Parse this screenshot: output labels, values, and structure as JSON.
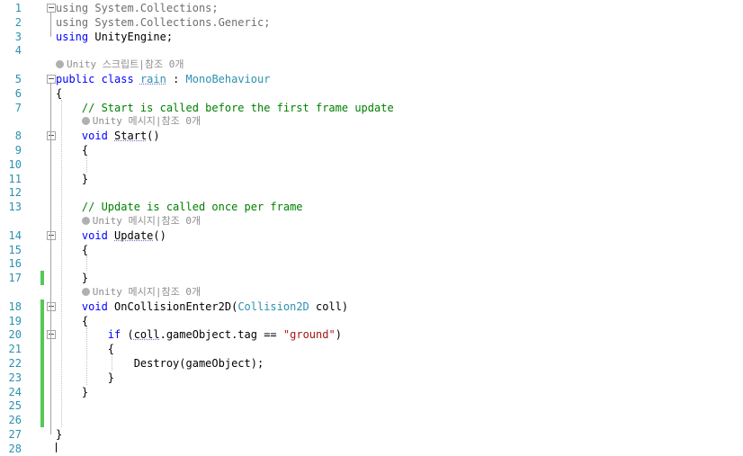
{
  "editor": {
    "language": "csharp",
    "lines": [
      {
        "num": "1",
        "segments": [
          {
            "t": "using",
            "c": "d"
          },
          {
            "t": " System.Collections;",
            "c": "d"
          }
        ]
      },
      {
        "num": "2",
        "segments": [
          {
            "t": "using",
            "c": "d"
          },
          {
            "t": " System.Collections.Generic;",
            "c": "d"
          }
        ]
      },
      {
        "num": "3",
        "segments": [
          {
            "t": "using",
            "c": "k"
          },
          {
            "t": " UnityEngine;",
            "c": ""
          }
        ]
      },
      {
        "num": "4",
        "segments": []
      },
      {
        "lens": "Unity 스크립트|참조 0개"
      },
      {
        "num": "5",
        "segments": [
          {
            "t": "public",
            "c": "k"
          },
          {
            "t": " ",
            "c": ""
          },
          {
            "t": "class",
            "c": "k"
          },
          {
            "t": " ",
            "c": ""
          },
          {
            "t": "rain",
            "c": "t sq"
          },
          {
            "t": " : ",
            "c": ""
          },
          {
            "t": "MonoBehaviour",
            "c": "t"
          }
        ]
      },
      {
        "num": "6",
        "segments": [
          {
            "t": "{",
            "c": ""
          }
        ]
      },
      {
        "num": "7",
        "segments": [
          {
            "t": "    // Start is called before the first frame update",
            "c": "c"
          }
        ]
      },
      {
        "lens": "Unity 메시지|참조 0개"
      },
      {
        "num": "8",
        "segments": [
          {
            "t": "    ",
            "c": ""
          },
          {
            "t": "void",
            "c": "k"
          },
          {
            "t": " ",
            "c": ""
          },
          {
            "t": "Start",
            "c": "sq"
          },
          {
            "t": "()",
            "c": ""
          }
        ]
      },
      {
        "num": "9",
        "segments": [
          {
            "t": "    {",
            "c": ""
          }
        ]
      },
      {
        "num": "10",
        "segments": []
      },
      {
        "num": "11",
        "segments": [
          {
            "t": "    }",
            "c": ""
          }
        ]
      },
      {
        "num": "12",
        "segments": []
      },
      {
        "num": "13",
        "segments": [
          {
            "t": "    // Update is called once per frame",
            "c": "c"
          }
        ]
      },
      {
        "lens": "Unity 메시지|참조 0개"
      },
      {
        "num": "14",
        "segments": [
          {
            "t": "    ",
            "c": ""
          },
          {
            "t": "void",
            "c": "k"
          },
          {
            "t": " ",
            "c": ""
          },
          {
            "t": "Update",
            "c": "sq"
          },
          {
            "t": "()",
            "c": ""
          }
        ]
      },
      {
        "num": "15",
        "segments": [
          {
            "t": "    {",
            "c": ""
          }
        ]
      },
      {
        "num": "16",
        "segments": []
      },
      {
        "num": "17",
        "segments": [
          {
            "t": "    }",
            "c": ""
          }
        ]
      },
      {
        "lens": "Unity 메시지|참조 0개"
      },
      {
        "num": "18",
        "segments": [
          {
            "t": "    ",
            "c": ""
          },
          {
            "t": "void",
            "c": "k"
          },
          {
            "t": " OnCollisionEnter2D(",
            "c": ""
          },
          {
            "t": "Collision2D",
            "c": "t"
          },
          {
            "t": " coll)",
            "c": ""
          }
        ]
      },
      {
        "num": "19",
        "segments": [
          {
            "t": "    {",
            "c": ""
          }
        ]
      },
      {
        "num": "20",
        "segments": [
          {
            "t": "        ",
            "c": ""
          },
          {
            "t": "if",
            "c": "k"
          },
          {
            "t": " (",
            "c": ""
          },
          {
            "t": "coll",
            "c": "sq"
          },
          {
            "t": ".gameObject.tag == ",
            "c": ""
          },
          {
            "t": "\"ground\"",
            "c": "s"
          },
          {
            "t": ")",
            "c": ""
          }
        ]
      },
      {
        "num": "21",
        "segments": [
          {
            "t": "        {",
            "c": ""
          }
        ]
      },
      {
        "num": "22",
        "segments": [
          {
            "t": "            Destroy(gameObject);",
            "c": ""
          }
        ]
      },
      {
        "num": "23",
        "segments": [
          {
            "t": "        }",
            "c": ""
          }
        ]
      },
      {
        "num": "24",
        "segments": [
          {
            "t": "    }",
            "c": ""
          }
        ]
      },
      {
        "num": "25",
        "segments": []
      },
      {
        "num": "26",
        "segments": []
      },
      {
        "num": "27",
        "segments": [
          {
            "t": "}",
            "c": ""
          }
        ]
      },
      {
        "num": "28",
        "segments": []
      }
    ]
  },
  "colors": {
    "keyword": "#0000ff",
    "type": "#2b91af",
    "string": "#a31515",
    "comment": "#008000",
    "unused_using": "#6e6e6e",
    "line_number": "#2b91af",
    "change_bar": "#57c757",
    "codelens": "#8e8e8e"
  },
  "icons": {
    "codelens": "unity-circle-icon",
    "fold": "collapse-minus-icon"
  }
}
